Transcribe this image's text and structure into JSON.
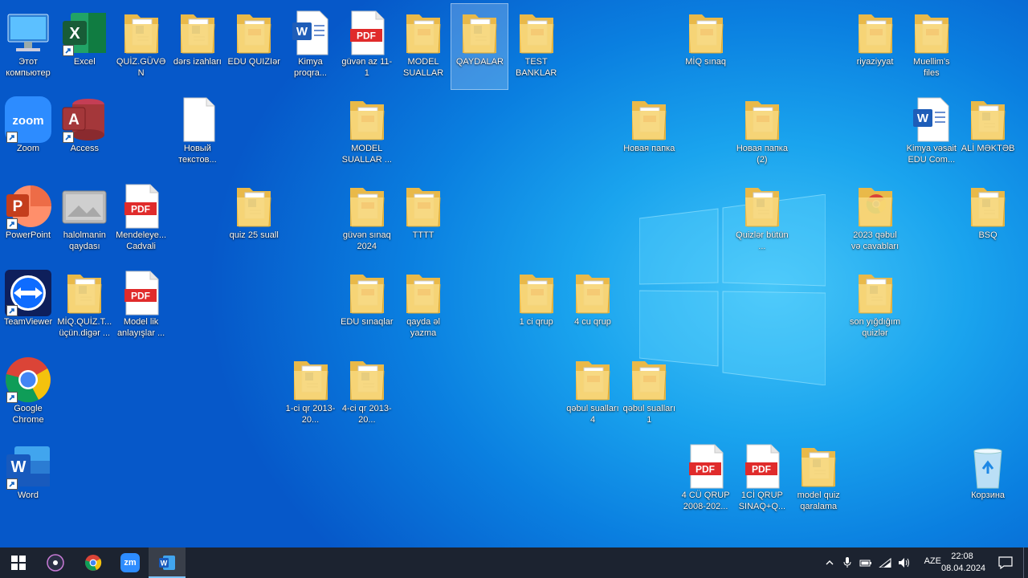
{
  "desktop": {
    "icons": [
      {
        "label": "Этот компьютер",
        "type": "computer"
      },
      {
        "label": "Excel",
        "type": "excel",
        "shortcut": true
      },
      {
        "label": "QUİZ.GÜVƏN",
        "type": "folder-doc"
      },
      {
        "label": "dərs izahları",
        "type": "folder-doc"
      },
      {
        "label": "EDU QUIZIər",
        "type": "folder-pdf"
      },
      {
        "label": "Kimya proqra...",
        "type": "word-doc"
      },
      {
        "label": "güvən az 11-1",
        "type": "pdf"
      },
      {
        "label": "MODEL SUALLAR",
        "type": "folder-pdf"
      },
      {
        "label": "QAYDALAR",
        "type": "folder-doc",
        "selected": true
      },
      {
        "label": "TEST BANKLAR",
        "type": "folder-pdf"
      },
      {
        "label": "MİQ sınaq",
        "type": "folder-pdf"
      },
      {
        "label": "riyaziyyat",
        "type": "folder-pdf"
      },
      {
        "label": "Muellim's files",
        "type": "folder-pdf"
      },
      {
        "label": "Zoom",
        "type": "zoom",
        "shortcut": true
      },
      {
        "label": "Access",
        "type": "access",
        "shortcut": true
      },
      {
        "label": "Новый текстов...",
        "type": "text"
      },
      {
        "label": "MODEL SUALLAR ...",
        "type": "folder-pdf"
      },
      {
        "label": "Новая папка",
        "type": "folder-pdf"
      },
      {
        "label": "Новая папка (2)",
        "type": "folder-pdf"
      },
      {
        "label": "Kimya vəsait EDU Com...",
        "type": "word-doc"
      },
      {
        "label": "ALİ MƏKTƏB",
        "type": "folder-doc"
      },
      {
        "label": "PowerPoint",
        "type": "powerpoint",
        "shortcut": true
      },
      {
        "label": "halolmanin qaydası",
        "type": "photo"
      },
      {
        "label": "Mendeleye... Cadvali",
        "type": "pdf"
      },
      {
        "label": "quiz 25 suall",
        "type": "folder-doc"
      },
      {
        "label": "güvən sınaq 2024",
        "type": "folder-pdf"
      },
      {
        "label": "TTTT",
        "type": "folder-pdf"
      },
      {
        "label": "Quizlər bütün ...",
        "type": "folder-doc"
      },
      {
        "label": "2023 qəbul və cavabları",
        "type": "folder-chrome"
      },
      {
        "label": "BSQ",
        "type": "folder-doc"
      },
      {
        "label": "TeamViewer",
        "type": "teamviewer",
        "shortcut": true
      },
      {
        "label": "MİQ.QUİZ.T... üçün.digər ...",
        "type": "folder-doc"
      },
      {
        "label": "Model lik anlayışlar ...",
        "type": "pdf"
      },
      {
        "label": "EDU sınaqlar",
        "type": "folder-pdf"
      },
      {
        "label": "qayda əl yazma",
        "type": "folder-pdf"
      },
      {
        "label": "1 ci qrup",
        "type": "folder-pdf"
      },
      {
        "label": "4 cu qrup",
        "type": "folder-pdf"
      },
      {
        "label": "son yığdığım quizlər",
        "type": "folder-doc"
      },
      {
        "label": "Google Chrome",
        "type": "chrome",
        "shortcut": true
      },
      {
        "label": "1-ci qr 2013-20...",
        "type": "folder-doc"
      },
      {
        "label": "4-ci qr 2013-20...",
        "type": "folder-doc"
      },
      {
        "label": "qəbul sualları 4",
        "type": "folder-pdf"
      },
      {
        "label": "qəbul sualları 1",
        "type": "folder-pdf"
      },
      {
        "label": "Word",
        "type": "word",
        "shortcut": true
      },
      {
        "label": "4 CÜ QRUP 2008-202...",
        "type": "pdf"
      },
      {
        "label": "1Cİ QRUP SINAQ+Q...",
        "type": "pdf"
      },
      {
        "label": "model quiz qaralama",
        "type": "folder-doc"
      },
      {
        "label": "Корзина",
        "type": "recycle"
      }
    ]
  },
  "taskbar": {
    "items": [
      {
        "name": "start-button",
        "icon": "windows-logo-icon"
      },
      {
        "name": "taskbar-obs",
        "icon": "obs-icon"
      },
      {
        "name": "taskbar-chrome",
        "icon": "chrome-icon"
      },
      {
        "name": "taskbar-zoom",
        "icon": "zoom-icon",
        "text": "zm"
      },
      {
        "name": "taskbar-word",
        "icon": "word-icon",
        "active": true
      }
    ],
    "tray": {
      "language": "AZE",
      "time": "22:08",
      "date": "08.04.2024"
    }
  },
  "colors": {
    "taskbar_bg": "#1c2330",
    "desktop_blue": "#0a7fe0",
    "pdf_red": "#e02b2b",
    "word_blue": "#1e5db8",
    "folder_yellow": "#f6d67a"
  }
}
